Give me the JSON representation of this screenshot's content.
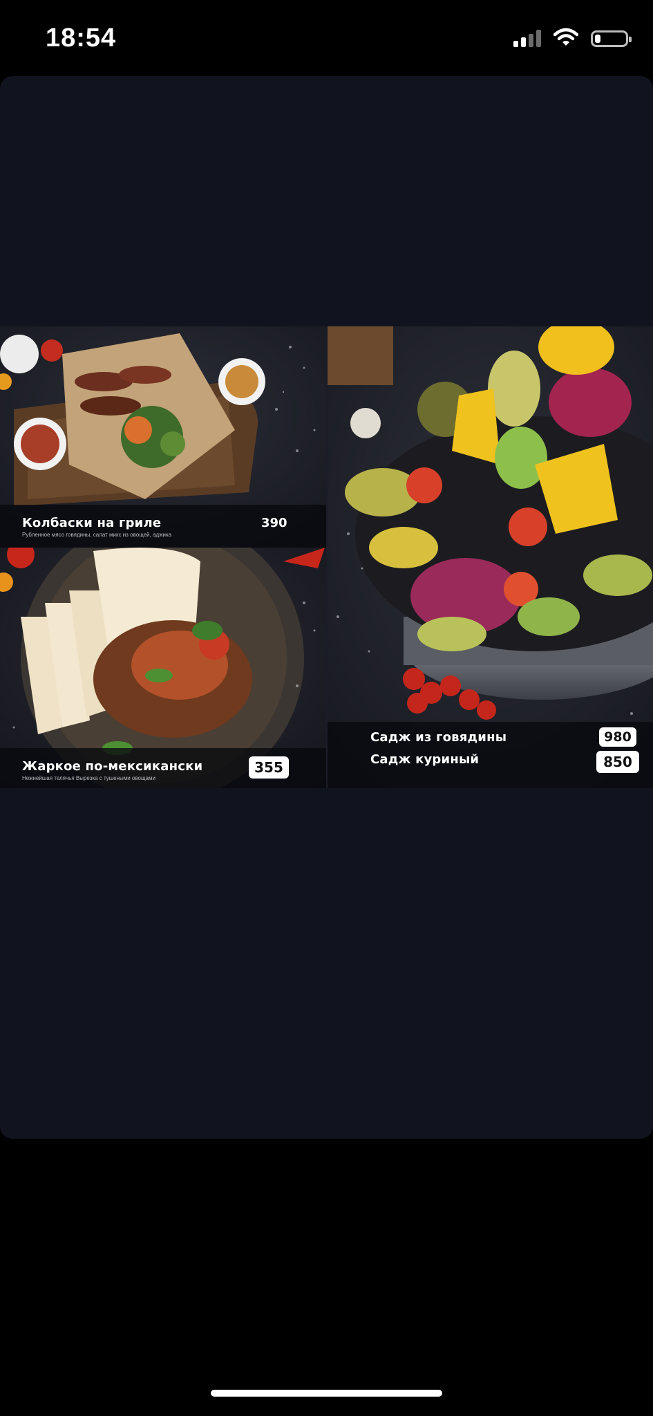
{
  "status_bar": {
    "time": "18:54",
    "signal_icon": "cellular-signal-icon",
    "wifi_icon": "wifi-icon",
    "battery_icon": "battery-icon",
    "battery_level": 0.2
  },
  "menu": {
    "dishes": [
      {
        "name": "Колбаски на гриле",
        "description": "Рубленное мясо говядины, салат микс из овощей, аджика",
        "price": "390"
      },
      {
        "name": "Жаркое по-мексикански",
        "description": "Нежнейшая телячья Вырезка с тушеными овощами",
        "price": "355"
      },
      {
        "name": "Садж из говядины",
        "price": "980"
      },
      {
        "name": "Садж куриный",
        "price": "850"
      }
    ]
  },
  "colors": {
    "viewer_background": "#11131f",
    "screen_background": "#000000",
    "text": "#ffffff"
  }
}
